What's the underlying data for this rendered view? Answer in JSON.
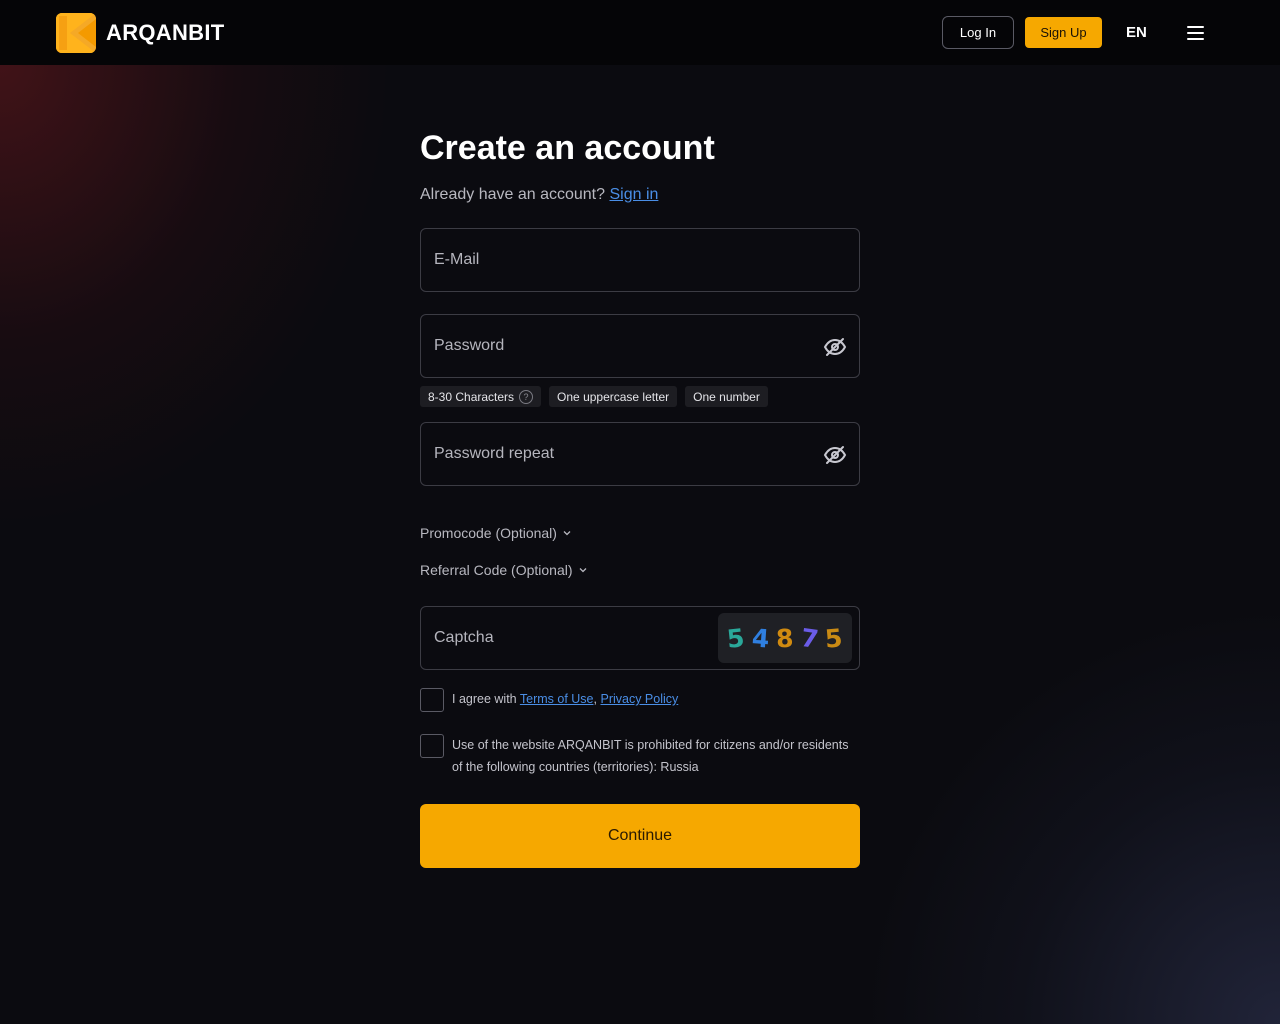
{
  "header": {
    "logo_text": "ARQANBIT",
    "login_label": "Log In",
    "signup_label": "Sign Up",
    "language": "EN"
  },
  "form": {
    "title": "Create an account",
    "have_account_text": "Already have an account?",
    "sign_in_link": "Sign in",
    "email_placeholder": "E-Mail",
    "password_placeholder": "Password",
    "password_hints": [
      "8-30 Characters",
      "One uppercase letter",
      "One number"
    ],
    "hint_help": "?",
    "password_repeat_placeholder": "Password repeat",
    "promocode_label": "Promocode (Optional)",
    "referral_label": "Referral Code (Optional)",
    "captcha_placeholder": "Captcha",
    "captcha_digits": [
      "5",
      "4",
      "8",
      "7",
      "5"
    ],
    "captcha_colors": [
      "#2aa89a",
      "#2f7fe0",
      "#d08a10",
      "#6b5ce8",
      "#c98a14"
    ],
    "agree_text": "I agree with",
    "terms_link": "Terms of Use",
    "separator": ",",
    "privacy_link": "Privacy Policy",
    "restriction_text": "Use of the website ARQANBIT is prohibited for citizens and/or residents of the following countries (territories): Russia",
    "continue_label": "Continue"
  },
  "colors": {
    "accent": "#f6a800",
    "link": "#4a8ee6",
    "background": "#0b0b10"
  }
}
